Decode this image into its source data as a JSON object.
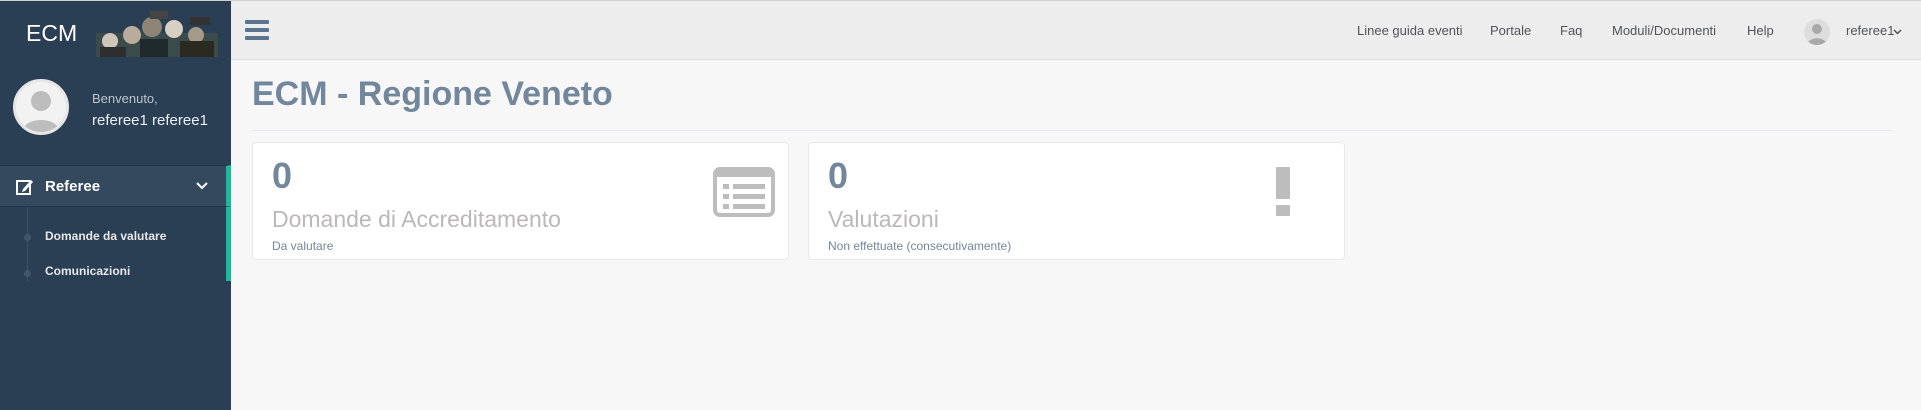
{
  "sidebar": {
    "title": "ECM",
    "welcome": "Benvenuto,",
    "username": "referee1 referee1",
    "menu": {
      "label": "Referee",
      "items": [
        {
          "label": "Domande da valutare"
        },
        {
          "label": "Comunicazioni"
        }
      ]
    }
  },
  "topnav": {
    "links": [
      "Linee guida eventi",
      "Portale",
      "Faq",
      "Moduli/Documenti",
      "Help"
    ],
    "user": "referee1"
  },
  "page": {
    "title": "ECM - Regione Veneto"
  },
  "tiles": [
    {
      "count": "0",
      "heading": "Domande di Accreditamento",
      "sub": "Da valutare",
      "icon": "list-alt-icon"
    },
    {
      "count": "0",
      "heading": "Valutazioni",
      "sub": "Non effettuate (consecutivamente)",
      "icon": "exclamation-icon"
    }
  ],
  "colors": {
    "sidebar_bg": "#2a3f54",
    "accent": "#1abb9c",
    "title": "#73879c"
  }
}
